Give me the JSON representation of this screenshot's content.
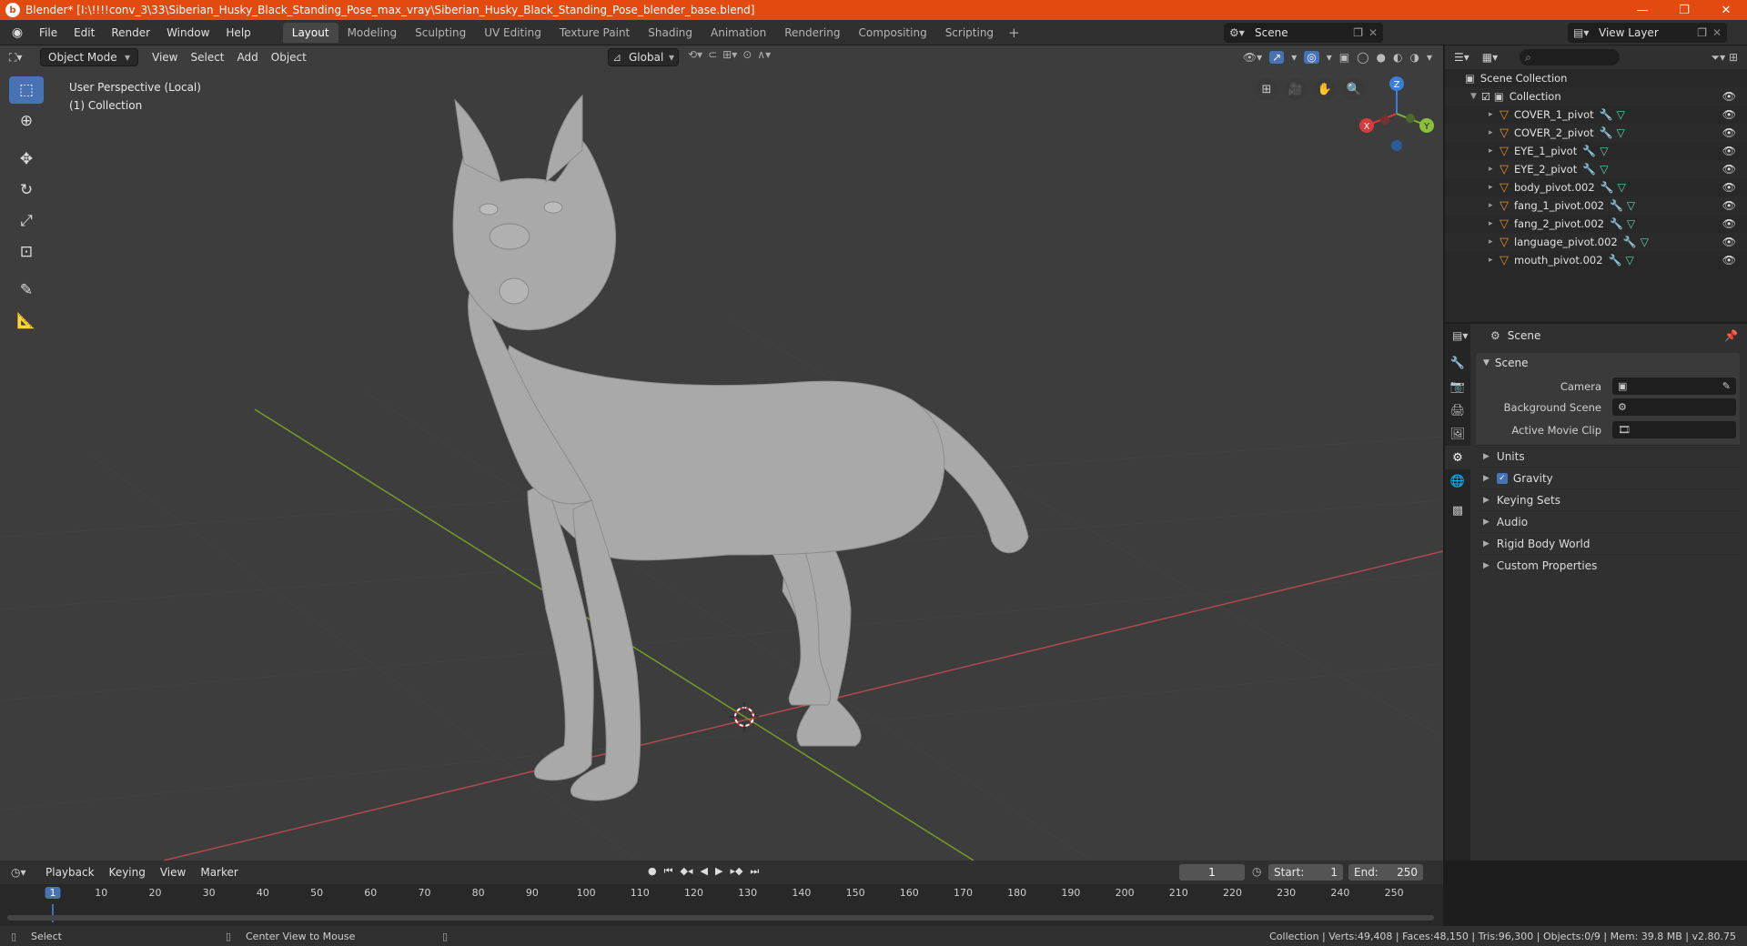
{
  "window": {
    "title": "Blender* [I:\\!!!!conv_3\\33\\Siberian_Husky_Black_Standing_Pose_max_vray\\Siberian_Husky_Black_Standing_Pose_blender_base.blend]",
    "minimize": "—",
    "maximize": "❐",
    "close": "✕"
  },
  "menubar": {
    "items": [
      "File",
      "Edit",
      "Render",
      "Window",
      "Help"
    ]
  },
  "workspaces": {
    "tabs": [
      "Layout",
      "Modeling",
      "Sculpting",
      "UV Editing",
      "Texture Paint",
      "Shading",
      "Animation",
      "Rendering",
      "Compositing",
      "Scripting"
    ],
    "active": "Layout",
    "add": "+"
  },
  "scene_selector": {
    "value": "Scene"
  },
  "view_layer": {
    "value": "View Layer"
  },
  "viewport": {
    "mode": "Object Mode",
    "menu": [
      "View",
      "Select",
      "Add",
      "Object"
    ],
    "orientation": "Global",
    "info_line1": "User Perspective (Local)",
    "info_line2": "(1) Collection",
    "gizmo_axes": {
      "x": "X",
      "y": "Y",
      "z": "Z"
    },
    "colors": {
      "background": "#3d3d3d",
      "x_axis": "#b04a4a",
      "y_axis": "#7a9a2a",
      "model": "#a8a8a8"
    }
  },
  "outliner": {
    "scene_collection": "Scene Collection",
    "collection": "Collection",
    "objects": [
      "COVER_1_pivot",
      "COVER_2_pivot",
      "EYE_1_pivot",
      "EYE_2_pivot",
      "body_pivot.002",
      "fang_1_pivot.002",
      "fang_2_pivot.002",
      "language_pivot.002",
      "mouth_pivot.002"
    ]
  },
  "properties": {
    "context": "Scene",
    "panel_title": "Scene",
    "fields": [
      {
        "label": "Camera",
        "value": ""
      },
      {
        "label": "Background Scene",
        "value": ""
      },
      {
        "label": "Active Movie Clip",
        "value": ""
      }
    ],
    "subpanels": [
      "Units",
      "Gravity",
      "Keying Sets",
      "Audio",
      "Rigid Body World",
      "Custom Properties"
    ]
  },
  "timeline": {
    "menu": [
      "Playback",
      "Keying",
      "View",
      "Marker"
    ],
    "current_frame": "1",
    "start_label": "Start:",
    "start": "1",
    "end_label": "End:",
    "end": "250",
    "ruler": [
      "1",
      "10",
      "20",
      "30",
      "40",
      "50",
      "60",
      "70",
      "80",
      "90",
      "100",
      "110",
      "120",
      "130",
      "140",
      "150",
      "160",
      "170",
      "180",
      "190",
      "200",
      "210",
      "220",
      "230",
      "240",
      "250"
    ]
  },
  "statusbar": {
    "left1": "Select",
    "left2": "Center View to Mouse",
    "stats": "Collection | Verts:49,408 | Faces:48,150 | Tris:96,300 | Objects:0/9 | Mem: 39.8 MB | v2.80.75"
  }
}
